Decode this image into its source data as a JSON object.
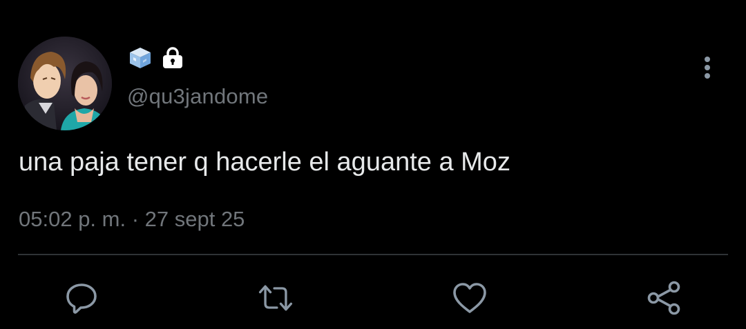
{
  "tweet": {
    "handle": "@qu3jandome",
    "text": "una paja tener q hacerle el aguante a Moz",
    "timestamp": "05:02 p. m. · 27 sept 25",
    "badges": [
      "ice-cube-emoji-icon",
      "lock-icon"
    ]
  },
  "actions": {
    "icons": [
      "reply-icon",
      "retweet-icon",
      "like-icon",
      "share-icon"
    ]
  },
  "colors": {
    "background": "#000000",
    "text": "#e7e9ea",
    "secondary": "#71767b",
    "divider": "#2f3336",
    "icon": "#8b98a5"
  }
}
